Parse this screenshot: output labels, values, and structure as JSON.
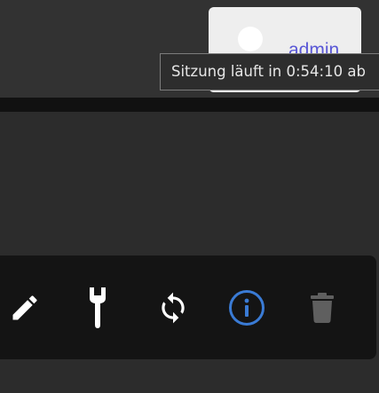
{
  "header": {
    "user_menu": {
      "username": "admin"
    },
    "session_tooltip": "Sitzung läuft in 0:54:10 ab"
  },
  "toolbar": {
    "icons": [
      "pencil-icon",
      "wrench-icon",
      "sync-icon",
      "info-icon",
      "trash-icon"
    ]
  },
  "colors": {
    "header_bg": "#323232",
    "content_bg": "#2c2c2c",
    "toolbar_bg": "#141414",
    "accent_info": "#3a7bd5",
    "username": "#5957d6",
    "disabled_icon": "#5f5f5f"
  }
}
